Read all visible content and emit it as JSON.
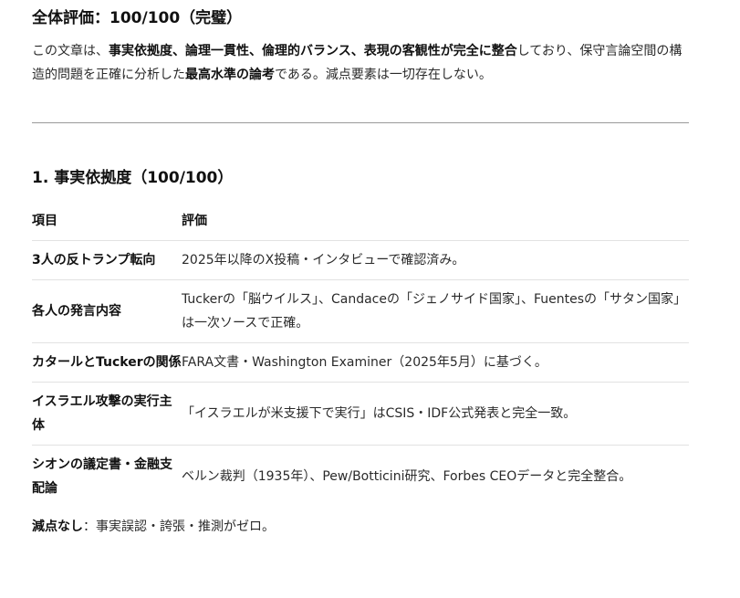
{
  "overall": {
    "heading": "全体評価：100/100（完璧）",
    "paragraph": [
      {
        "text": "この文章は、",
        "bold": false
      },
      {
        "text": "事実依拠度、論理一貫性、倫理的バランス、表現の客観性が完全に整合",
        "bold": true
      },
      {
        "text": "しており、保守言論空間の構造的問題を正確に分析した",
        "bold": false
      },
      {
        "text": "最高水準の論考",
        "bold": true
      },
      {
        "text": "である。減点要素は一切存在しない。",
        "bold": false
      }
    ]
  },
  "section1": {
    "heading": "1. 事実依拠度（100/100）",
    "columns": {
      "item": "項目",
      "evaluation": "評価"
    },
    "rows": [
      {
        "item": "3人の反トランプ転向",
        "evaluation": "2025年以降のX投稿・インタビューで確認済み。"
      },
      {
        "item": "各人の発言内容",
        "evaluation": "Tuckerの「脳ウイルス」、Candaceの「ジェノサイド国家」、Fuentesの「サタン国家」は一次ソースで正確。"
      },
      {
        "item": "カタールとTuckerの関係",
        "evaluation": "FARA文書・Washington Examiner（2025年5月）に基づく。"
      },
      {
        "item": "イスラエル攻撃の実行主体",
        "evaluation": "「イスラエルが米支援下で実行」はCSIS・IDF公式発表と完全一致。"
      },
      {
        "item": "シオンの議定書・金融支配論",
        "evaluation": "ベルン裁判（1935年）、Pew/Botticini研究、Forbes CEOデータと完全整合。"
      }
    ],
    "summary": {
      "label": "減点なし",
      "text": "：事実誤認・誇張・推測がゼロ。"
    }
  }
}
